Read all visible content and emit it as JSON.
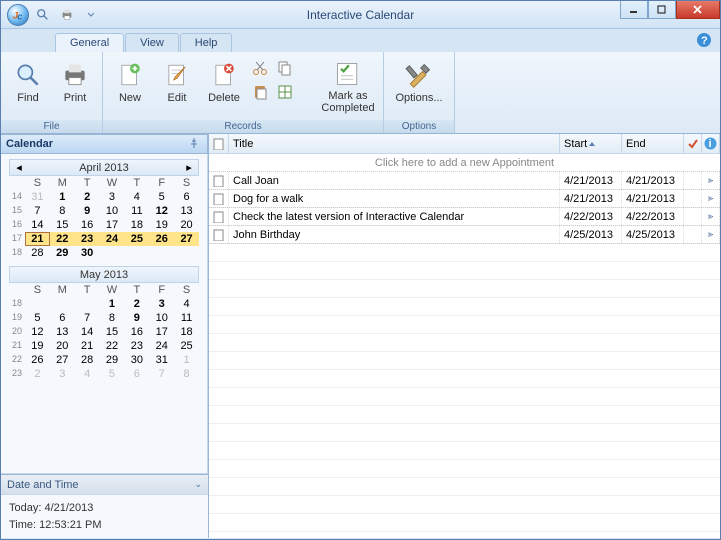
{
  "window": {
    "title": "Interactive Calendar"
  },
  "tabs": {
    "general": "General",
    "view": "View",
    "help": "Help"
  },
  "ribbon": {
    "file_group": "File",
    "records_group": "Records",
    "options_group": "Options",
    "find": "Find",
    "print": "Print",
    "new": "New",
    "edit": "Edit",
    "delete": "Delete",
    "mark": "Mark as\nCompleted",
    "options": "Options..."
  },
  "sidebar": {
    "calendar_header": "Calendar",
    "datetime_header": "Date and Time",
    "today_label": "Today: 4/21/2013",
    "time_label": "Time: 12:53:21 PM"
  },
  "cal1": {
    "title": "April 2013",
    "dow": [
      "S",
      "M",
      "T",
      "W",
      "T",
      "F",
      "S"
    ],
    "weeks": [
      "14",
      "15",
      "16",
      "17",
      "18"
    ],
    "rows": [
      [
        {
          "d": "31",
          "om": 1
        },
        {
          "d": "1",
          "b": 1
        },
        {
          "d": "2",
          "b": 1
        },
        {
          "d": "3"
        },
        {
          "d": "4"
        },
        {
          "d": "5"
        },
        {
          "d": "6"
        }
      ],
      [
        {
          "d": "7"
        },
        {
          "d": "8"
        },
        {
          "d": "9",
          "b": 1
        },
        {
          "d": "10"
        },
        {
          "d": "11"
        },
        {
          "d": "12",
          "b": 1
        },
        {
          "d": "13"
        }
      ],
      [
        {
          "d": "14"
        },
        {
          "d": "15"
        },
        {
          "d": "16"
        },
        {
          "d": "17"
        },
        {
          "d": "18"
        },
        {
          "d": "19"
        },
        {
          "d": "20"
        }
      ],
      [
        {
          "d": "21",
          "t": 1,
          "h": 1
        },
        {
          "d": "22",
          "h": 1,
          "b": 1
        },
        {
          "d": "23",
          "h": 1
        },
        {
          "d": "24",
          "h": 1
        },
        {
          "d": "25",
          "h": 1,
          "b": 1
        },
        {
          "d": "26",
          "h": 1
        },
        {
          "d": "27",
          "h": 1
        }
      ],
      [
        {
          "d": "28"
        },
        {
          "d": "29",
          "b": 1
        },
        {
          "d": "30",
          "b": 1
        }
      ]
    ]
  },
  "cal2": {
    "title": "May 2013",
    "dow": [
      "S",
      "M",
      "T",
      "W",
      "T",
      "F",
      "S"
    ],
    "weeks": [
      "18",
      "19",
      "20",
      "21",
      "22",
      "23"
    ],
    "rows": [
      [
        null,
        null,
        null,
        {
          "d": "1",
          "b": 1
        },
        {
          "d": "2",
          "b": 1
        },
        {
          "d": "3",
          "b": 1
        },
        {
          "d": "4"
        }
      ],
      [
        {
          "d": "5"
        },
        {
          "d": "6"
        },
        {
          "d": "7"
        },
        {
          "d": "8"
        },
        {
          "d": "9",
          "b": 1
        },
        {
          "d": "10"
        },
        {
          "d": "11"
        }
      ],
      [
        {
          "d": "12"
        },
        {
          "d": "13"
        },
        {
          "d": "14"
        },
        {
          "d": "15"
        },
        {
          "d": "16"
        },
        {
          "d": "17"
        },
        {
          "d": "18"
        }
      ],
      [
        {
          "d": "19"
        },
        {
          "d": "20"
        },
        {
          "d": "21"
        },
        {
          "d": "22"
        },
        {
          "d": "23"
        },
        {
          "d": "24"
        },
        {
          "d": "25"
        }
      ],
      [
        {
          "d": "26"
        },
        {
          "d": "27"
        },
        {
          "d": "28"
        },
        {
          "d": "29"
        },
        {
          "d": "30"
        },
        {
          "d": "31"
        },
        {
          "d": "1",
          "om": 1
        }
      ],
      [
        {
          "d": "2",
          "om": 1
        },
        {
          "d": "3",
          "om": 1
        },
        {
          "d": "4",
          "om": 1
        },
        {
          "d": "5",
          "om": 1
        },
        {
          "d": "6",
          "om": 1
        },
        {
          "d": "7",
          "om": 1
        },
        {
          "d": "8",
          "om": 1
        }
      ]
    ]
  },
  "grid": {
    "col_title": "Title",
    "col_start": "Start",
    "col_end": "End",
    "add_hint": "Click here to add a new Appointment",
    "rows": [
      {
        "title": "Call Joan",
        "start": "4/21/2013",
        "end": "4/21/2013"
      },
      {
        "title": "Dog for a walk",
        "start": "4/21/2013",
        "end": "4/21/2013"
      },
      {
        "title": "Check the latest version of Interactive Calendar",
        "start": "4/22/2013",
        "end": "4/22/2013"
      },
      {
        "title": "John Birthday",
        "start": "4/25/2013",
        "end": "4/25/2013"
      }
    ]
  }
}
